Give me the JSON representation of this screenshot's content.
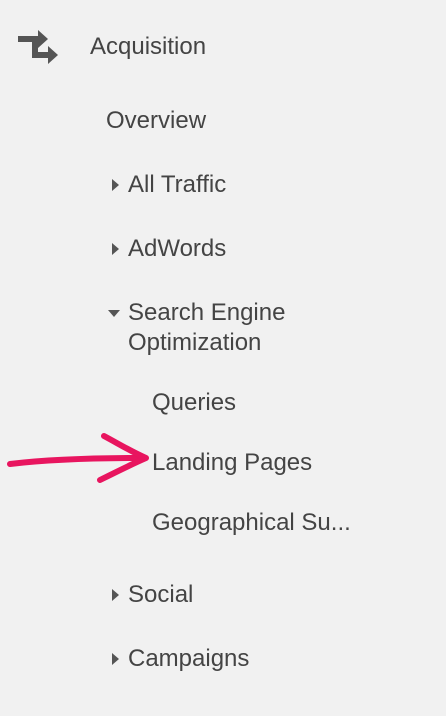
{
  "section": {
    "title": "Acquisition",
    "icon": "acquisition-arrows-icon"
  },
  "items": {
    "overview": "Overview",
    "all_traffic": "All Traffic",
    "adwords": "AdWords",
    "seo_line1": "Search Engine",
    "seo_line2": "Optimization",
    "queries": "Queries",
    "landing_pages": "Landing Pages",
    "geographical_summary": "Geographical Su...",
    "social": "Social",
    "campaigns": "Campaigns"
  },
  "annotation": {
    "icon": "pointer-arrow-icon",
    "color": "#e8155f"
  },
  "colors": {
    "background": "#f1f1f1",
    "text": "#444444",
    "caret": "#555555"
  }
}
